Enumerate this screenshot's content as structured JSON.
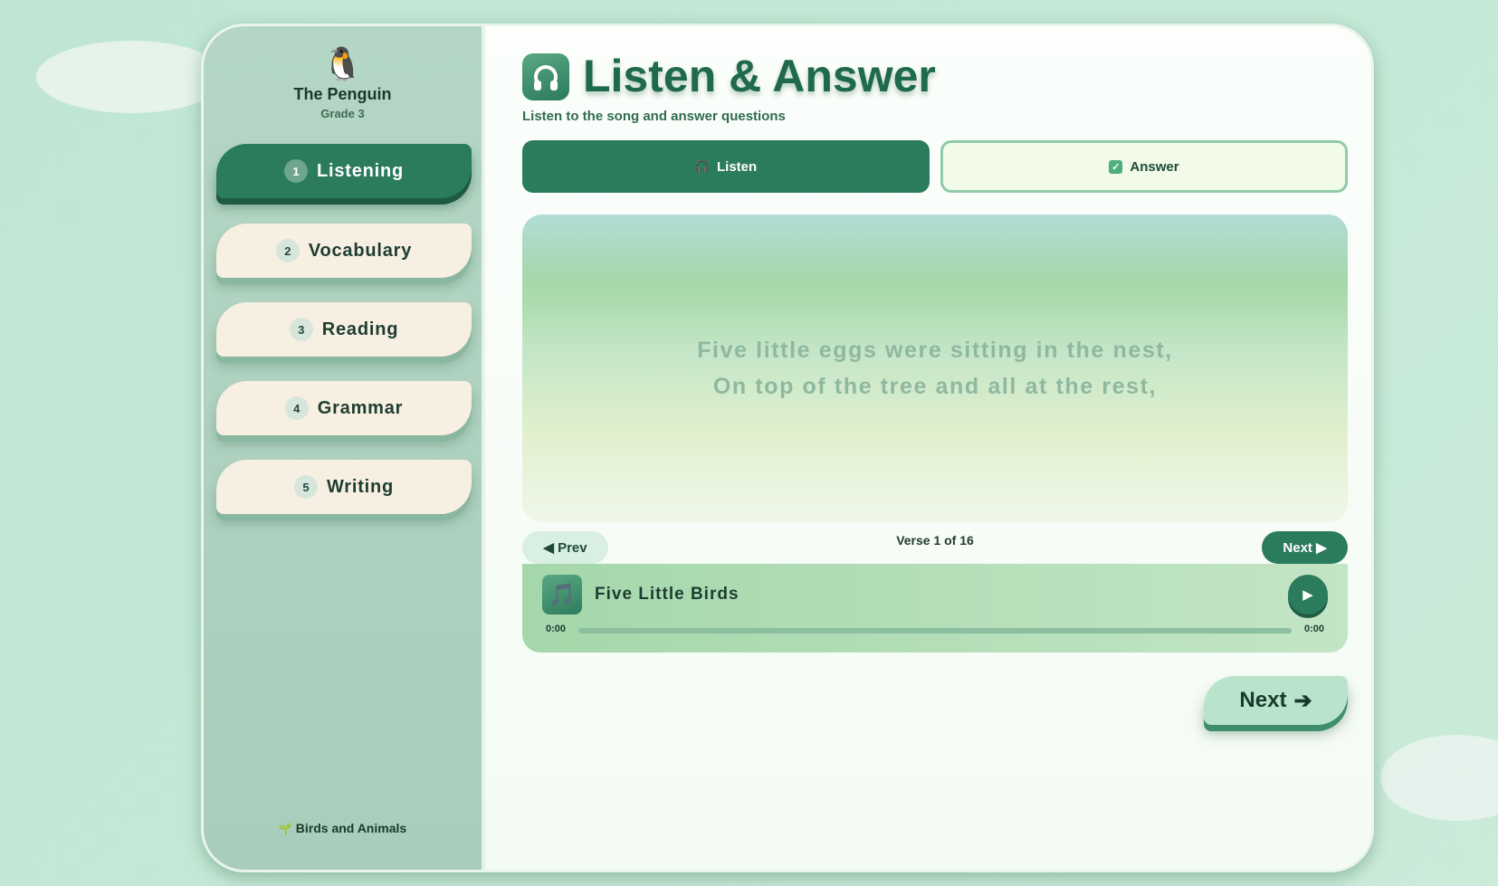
{
  "sidebar": {
    "mascot": "🐧",
    "book_title": "The Penguin",
    "grade": "Grade 3",
    "items": [
      {
        "num": "1",
        "label": "Listening",
        "active": true
      },
      {
        "num": "2",
        "label": "Vocabulary",
        "active": false
      },
      {
        "num": "3",
        "label": "Reading",
        "active": false
      },
      {
        "num": "4",
        "label": "Grammar",
        "active": false
      },
      {
        "num": "5",
        "label": "Writing",
        "active": false
      }
    ],
    "footer": {
      "icon": "🌱",
      "label": "Birds and Animals"
    }
  },
  "header": {
    "icon": "headphones-icon",
    "title": "Listen & Answer",
    "subtitle": "Listen to the song and answer questions"
  },
  "tabs": {
    "listen": {
      "icon": "🎧",
      "label": "Listen",
      "active": true
    },
    "answer": {
      "icon": "✓",
      "label": "Answer",
      "active": false
    }
  },
  "lyrics": {
    "lines": [
      "Five little eggs were sitting in the nest,",
      "On top of the tree and all at the rest,"
    ]
  },
  "verse_nav": {
    "prev_label": "◀ Prev",
    "verse_text": "Verse 1 of 16",
    "next_label": "Next ▶"
  },
  "player": {
    "icon": "🎵",
    "song_title": "Five Little Birds",
    "play_icon": "▶",
    "time_current": "0:00",
    "time_total": "0:00",
    "progress": 0
  },
  "footer_nav": {
    "next_label": "Next",
    "next_icon": "➔"
  },
  "colors": {
    "primary": "#2b7b5d",
    "accent_light": "#b9e3cb",
    "nav_bg": "#f6efe2"
  }
}
